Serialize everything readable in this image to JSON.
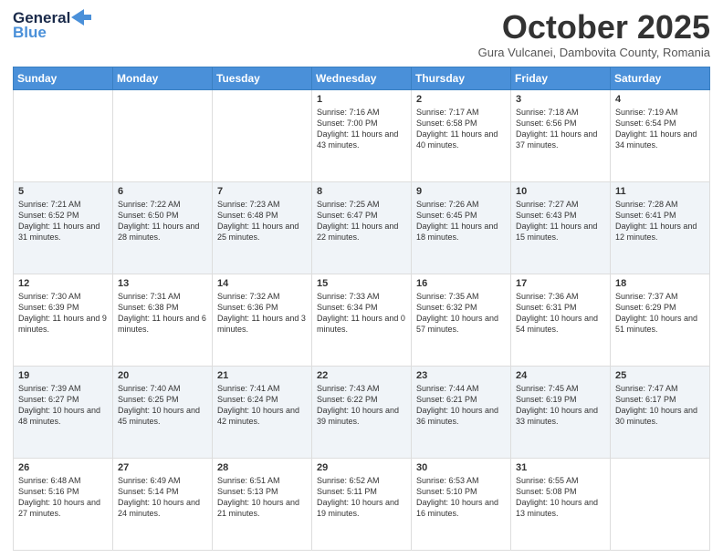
{
  "header": {
    "logo_general": "General",
    "logo_blue": "Blue",
    "month_title": "October 2025",
    "location": "Gura Vulcanei, Dambovita County, Romania"
  },
  "days_of_week": [
    "Sunday",
    "Monday",
    "Tuesday",
    "Wednesday",
    "Thursday",
    "Friday",
    "Saturday"
  ],
  "weeks": [
    [
      {
        "day": "",
        "info": ""
      },
      {
        "day": "",
        "info": ""
      },
      {
        "day": "",
        "info": ""
      },
      {
        "day": "1",
        "info": "Sunrise: 7:16 AM\nSunset: 7:00 PM\nDaylight: 11 hours and 43 minutes."
      },
      {
        "day": "2",
        "info": "Sunrise: 7:17 AM\nSunset: 6:58 PM\nDaylight: 11 hours and 40 minutes."
      },
      {
        "day": "3",
        "info": "Sunrise: 7:18 AM\nSunset: 6:56 PM\nDaylight: 11 hours and 37 minutes."
      },
      {
        "day": "4",
        "info": "Sunrise: 7:19 AM\nSunset: 6:54 PM\nDaylight: 11 hours and 34 minutes."
      }
    ],
    [
      {
        "day": "5",
        "info": "Sunrise: 7:21 AM\nSunset: 6:52 PM\nDaylight: 11 hours and 31 minutes."
      },
      {
        "day": "6",
        "info": "Sunrise: 7:22 AM\nSunset: 6:50 PM\nDaylight: 11 hours and 28 minutes."
      },
      {
        "day": "7",
        "info": "Sunrise: 7:23 AM\nSunset: 6:48 PM\nDaylight: 11 hours and 25 minutes."
      },
      {
        "day": "8",
        "info": "Sunrise: 7:25 AM\nSunset: 6:47 PM\nDaylight: 11 hours and 22 minutes."
      },
      {
        "day": "9",
        "info": "Sunrise: 7:26 AM\nSunset: 6:45 PM\nDaylight: 11 hours and 18 minutes."
      },
      {
        "day": "10",
        "info": "Sunrise: 7:27 AM\nSunset: 6:43 PM\nDaylight: 11 hours and 15 minutes."
      },
      {
        "day": "11",
        "info": "Sunrise: 7:28 AM\nSunset: 6:41 PM\nDaylight: 11 hours and 12 minutes."
      }
    ],
    [
      {
        "day": "12",
        "info": "Sunrise: 7:30 AM\nSunset: 6:39 PM\nDaylight: 11 hours and 9 minutes."
      },
      {
        "day": "13",
        "info": "Sunrise: 7:31 AM\nSunset: 6:38 PM\nDaylight: 11 hours and 6 minutes."
      },
      {
        "day": "14",
        "info": "Sunrise: 7:32 AM\nSunset: 6:36 PM\nDaylight: 11 hours and 3 minutes."
      },
      {
        "day": "15",
        "info": "Sunrise: 7:33 AM\nSunset: 6:34 PM\nDaylight: 11 hours and 0 minutes."
      },
      {
        "day": "16",
        "info": "Sunrise: 7:35 AM\nSunset: 6:32 PM\nDaylight: 10 hours and 57 minutes."
      },
      {
        "day": "17",
        "info": "Sunrise: 7:36 AM\nSunset: 6:31 PM\nDaylight: 10 hours and 54 minutes."
      },
      {
        "day": "18",
        "info": "Sunrise: 7:37 AM\nSunset: 6:29 PM\nDaylight: 10 hours and 51 minutes."
      }
    ],
    [
      {
        "day": "19",
        "info": "Sunrise: 7:39 AM\nSunset: 6:27 PM\nDaylight: 10 hours and 48 minutes."
      },
      {
        "day": "20",
        "info": "Sunrise: 7:40 AM\nSunset: 6:25 PM\nDaylight: 10 hours and 45 minutes."
      },
      {
        "day": "21",
        "info": "Sunrise: 7:41 AM\nSunset: 6:24 PM\nDaylight: 10 hours and 42 minutes."
      },
      {
        "day": "22",
        "info": "Sunrise: 7:43 AM\nSunset: 6:22 PM\nDaylight: 10 hours and 39 minutes."
      },
      {
        "day": "23",
        "info": "Sunrise: 7:44 AM\nSunset: 6:21 PM\nDaylight: 10 hours and 36 minutes."
      },
      {
        "day": "24",
        "info": "Sunrise: 7:45 AM\nSunset: 6:19 PM\nDaylight: 10 hours and 33 minutes."
      },
      {
        "day": "25",
        "info": "Sunrise: 7:47 AM\nSunset: 6:17 PM\nDaylight: 10 hours and 30 minutes."
      }
    ],
    [
      {
        "day": "26",
        "info": "Sunrise: 6:48 AM\nSunset: 5:16 PM\nDaylight: 10 hours and 27 minutes."
      },
      {
        "day": "27",
        "info": "Sunrise: 6:49 AM\nSunset: 5:14 PM\nDaylight: 10 hours and 24 minutes."
      },
      {
        "day": "28",
        "info": "Sunrise: 6:51 AM\nSunset: 5:13 PM\nDaylight: 10 hours and 21 minutes."
      },
      {
        "day": "29",
        "info": "Sunrise: 6:52 AM\nSunset: 5:11 PM\nDaylight: 10 hours and 19 minutes."
      },
      {
        "day": "30",
        "info": "Sunrise: 6:53 AM\nSunset: 5:10 PM\nDaylight: 10 hours and 16 minutes."
      },
      {
        "day": "31",
        "info": "Sunrise: 6:55 AM\nSunset: 5:08 PM\nDaylight: 10 hours and 13 minutes."
      },
      {
        "day": "",
        "info": ""
      }
    ]
  ]
}
